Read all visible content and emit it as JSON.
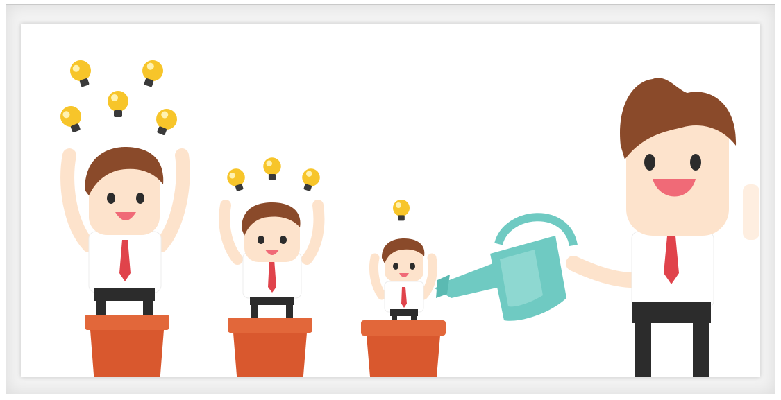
{
  "image": {
    "kind": "illustration",
    "theme": "employee growth and ideas",
    "colors": {
      "background": "#ffffff",
      "frame": "#f3f3f3",
      "pot": "#d9582e",
      "pot_rim": "#e2673a",
      "skin": "#fde3cc",
      "hair": "#8a4a2a",
      "tie": "#e0434b",
      "shirt": "#ffffff",
      "pants": "#2c2c2c",
      "bulb": "#f7c52a",
      "bulb_base": "#3a3a3a",
      "watering_can": "#6fcac2",
      "mouth": "#f06a77"
    },
    "elements": [
      {
        "name": "small-employee-in-pot",
        "bulbs": 1
      },
      {
        "name": "medium-employee-in-pot",
        "bulbs": 3
      },
      {
        "name": "large-employee-in-pot",
        "bulbs": 5
      },
      {
        "name": "manager-with-watering-can",
        "bulbs": 0
      }
    ]
  }
}
